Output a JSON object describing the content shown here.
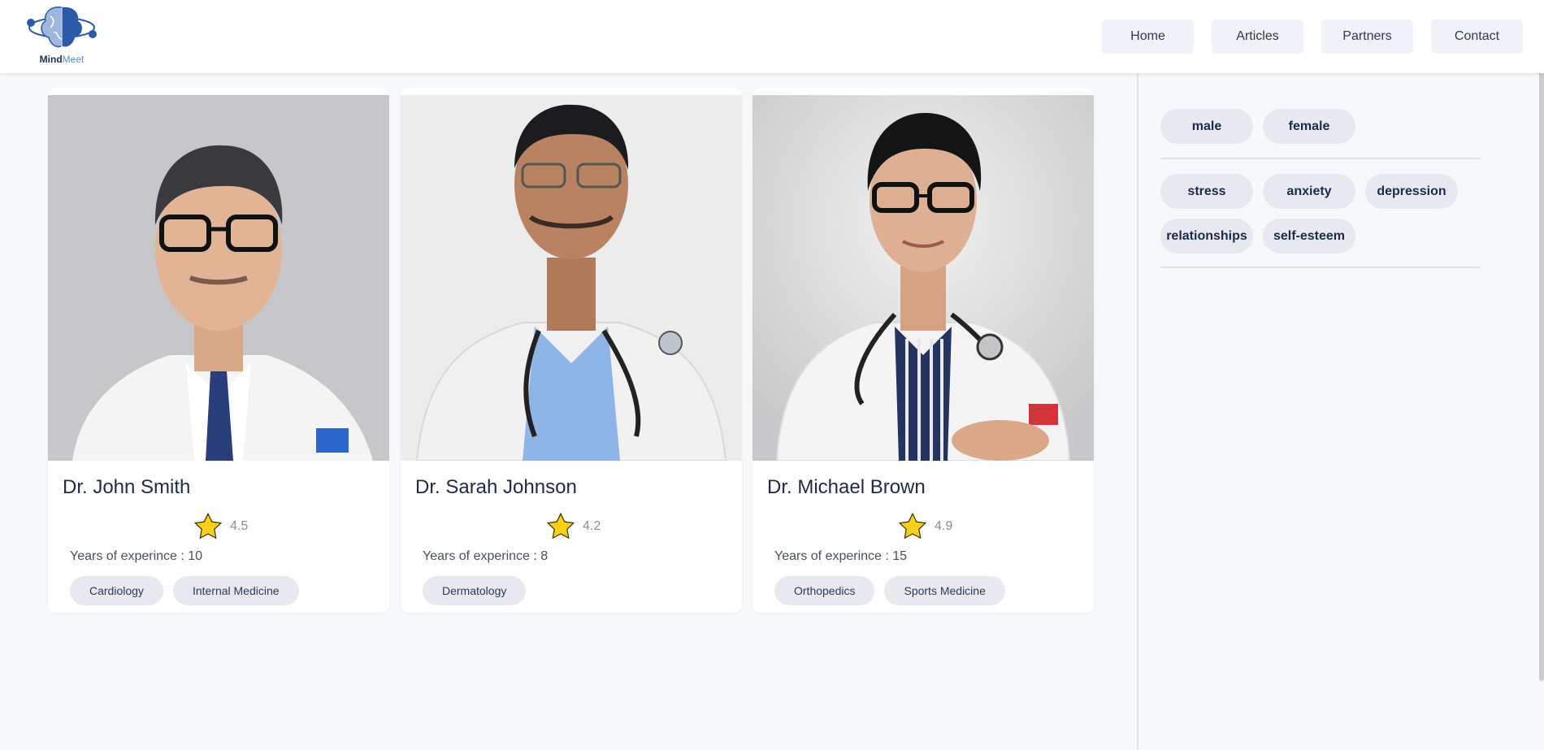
{
  "app": {
    "logo_bold": "Mind",
    "logo_light": "Meet"
  },
  "nav": {
    "home": "Home",
    "articles": "Articles",
    "partners": "Partners",
    "contact": "Contact"
  },
  "doctors": [
    {
      "name": "Dr. John Smith",
      "rating": "4.5",
      "experience": "Years of experince : 10",
      "tags": [
        "Cardiology",
        "Internal Medicine"
      ]
    },
    {
      "name": "Dr. Sarah Johnson",
      "rating": "4.2",
      "experience": "Years of experince : 8",
      "tags": [
        "Dermatology"
      ]
    },
    {
      "name": "Dr. Michael Brown",
      "rating": "4.9",
      "experience": "Years of experince : 15",
      "tags": [
        "Orthopedics",
        "Sports Medicine"
      ]
    }
  ],
  "filters": {
    "gender": [
      "male",
      "female"
    ],
    "topics": [
      "stress",
      "anxiety",
      "depression",
      "relationships",
      "self-esteem"
    ]
  },
  "colors": {
    "star": "#f7d117",
    "accent": "#2b5aa8",
    "chip_bg": "#e6e9ef"
  }
}
